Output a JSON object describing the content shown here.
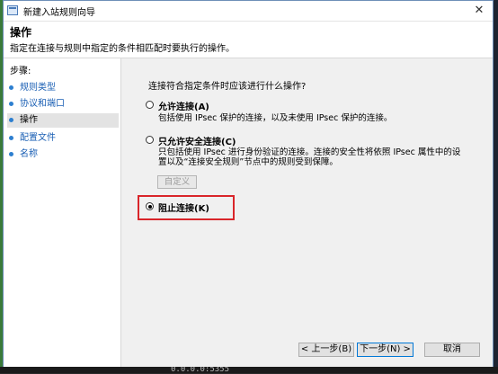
{
  "window": {
    "title": "新建入站规则向导",
    "close_glyph": "✕"
  },
  "header": {
    "title": "操作",
    "description": "指定在连接与规则中指定的条件相匹配时要执行的操作。"
  },
  "steps": {
    "label": "步骤:",
    "items": [
      {
        "label": "规则类型",
        "current": false
      },
      {
        "label": "协议和端口",
        "current": false
      },
      {
        "label": "操作",
        "current": true
      },
      {
        "label": "配置文件",
        "current": false
      },
      {
        "label": "名称",
        "current": false
      }
    ]
  },
  "content": {
    "question": "连接符合指定条件时应该进行什么操作?",
    "options": [
      {
        "label": "允许连接(A)",
        "description": [
          "包括使用 IPsec 保护的连接，以及未使用 IPsec 保护的连接。"
        ],
        "checked": false
      },
      {
        "label": "只允许安全连接(C)",
        "description": [
          "只包括使用 IPsec 进行身份验证的连接。连接的安全性将依照 IPsec 属性中的设",
          "置以及“连接安全规则”节点中的规则受到保障。"
        ],
        "checked": false
      },
      {
        "label": "阻止连接(K)",
        "description": [],
        "checked": true
      }
    ],
    "custom_button": "自定义"
  },
  "buttons": {
    "back": "< 上一步(B)",
    "next": "下一步(N) >",
    "cancel": "取消"
  },
  "background": {
    "bottom_text": "0.0.0.0:5355"
  }
}
